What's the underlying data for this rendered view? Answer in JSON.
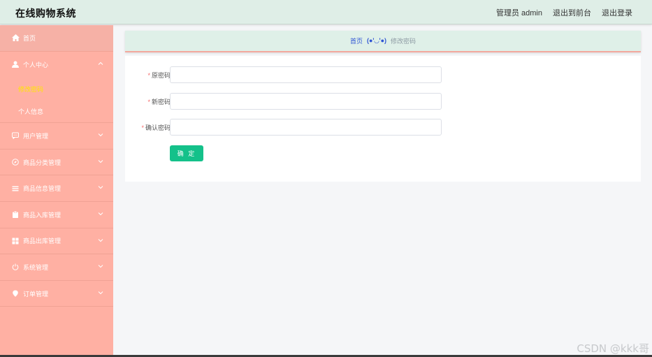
{
  "app": {
    "title": "在线购物系统"
  },
  "topnav": {
    "user": "管理员 admin",
    "front": "退出到前台",
    "logout": "退出登录"
  },
  "sidebar": {
    "home": "首页",
    "personal": {
      "label": "个人中心",
      "children": [
        "修改密码",
        "个人信息"
      ],
      "active_child": "修改密码"
    },
    "items": [
      {
        "label": "用户管理",
        "icon": "chat-icon"
      },
      {
        "label": "商品分类管理",
        "icon": "compass-icon"
      },
      {
        "label": "商品信息管理",
        "icon": "list-icon"
      },
      {
        "label": "商品入库管理",
        "icon": "clipboard-icon"
      },
      {
        "label": "商品出库管理",
        "icon": "grid-icon"
      },
      {
        "label": "系统管理",
        "icon": "power-icon"
      },
      {
        "label": "订单管理",
        "icon": "location-icon"
      }
    ]
  },
  "breadcrumb": {
    "home": "首页",
    "face": "(●'◡'●)",
    "current": "修改密码"
  },
  "form": {
    "old_label": "原密码",
    "new_label": "新密码",
    "confirm_label": "确认密码",
    "old_value": "",
    "new_value": "",
    "confirm_value": "",
    "submit": "确 定"
  },
  "watermark": "CSDN @kkk哥",
  "colors": {
    "sidebar": "#ffb0a3",
    "topbar": "#dfeee7",
    "accent_button": "#14c18a",
    "active_sub": "#ffe600",
    "link": "#2f55d4"
  }
}
